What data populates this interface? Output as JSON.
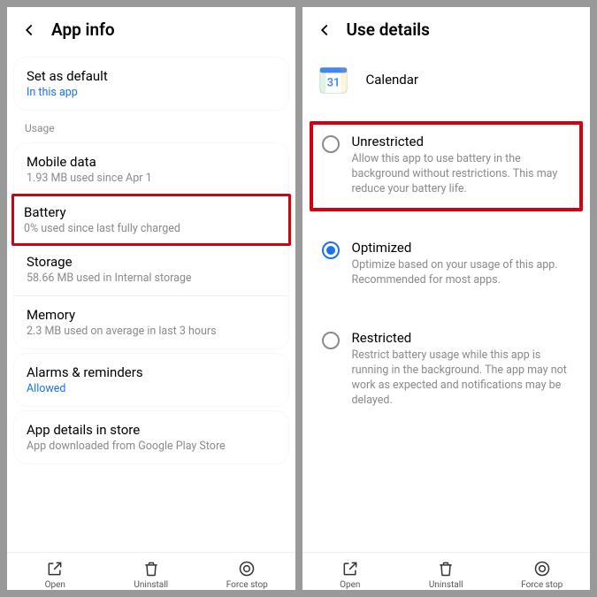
{
  "left": {
    "header": "App info",
    "default": {
      "title": "Set as default",
      "sub": "In this app"
    },
    "usage_header": "Usage",
    "mobile_data": {
      "title": "Mobile data",
      "sub": "1.93 MB used since Apr 1"
    },
    "battery": {
      "title": "Battery",
      "sub": "0% used since last fully charged"
    },
    "storage": {
      "title": "Storage",
      "sub": "58.66 MB used in Internal storage"
    },
    "memory": {
      "title": "Memory",
      "sub": "2.3 MB used on average in last 3 hours"
    },
    "alarms": {
      "title": "Alarms & reminders",
      "sub": "Allowed"
    },
    "details": {
      "title": "App details in store",
      "sub": "App downloaded from Google Play Store"
    },
    "bottom": {
      "open": "Open",
      "uninstall": "Uninstall",
      "force": "Force stop"
    }
  },
  "right": {
    "header": "Use details",
    "app_name": "Calendar",
    "unrestricted": {
      "title": "Unrestricted",
      "desc": "Allow this app to use battery in the background without restrictions. This may reduce your battery life."
    },
    "optimized": {
      "title": "Optimized",
      "desc": "Optimize based on your usage of this app. Recommended for most apps."
    },
    "restricted": {
      "title": "Restricted",
      "desc": "Restrict battery usage while this app is running in the background. The app may not work as expected and notifications may be delayed."
    },
    "bottom": {
      "open": "Open",
      "uninstall": "Uninstall",
      "force": "Force stop"
    }
  }
}
